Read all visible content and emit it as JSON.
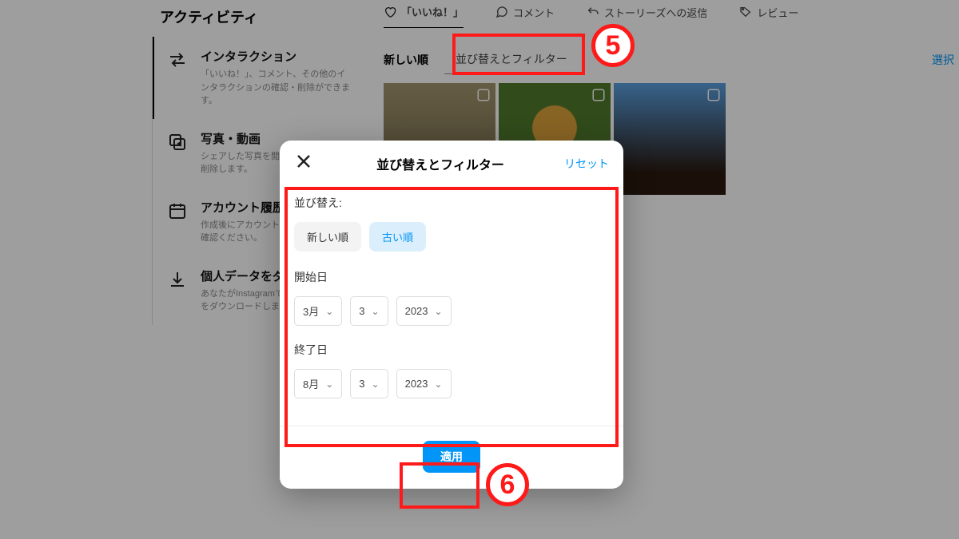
{
  "page_title": "アクティビティ",
  "tabs": [
    {
      "label": "「いいね！」"
    },
    {
      "label": "コメント"
    },
    {
      "label": "ストーリーズへの返信"
    },
    {
      "label": "レビュー"
    }
  ],
  "sidebar": {
    "items": [
      {
        "label": "インタラクション",
        "desc": "「いいね！」、コメント、その他のインタラクションの確認・削除ができます。"
      },
      {
        "label": "写真・動画",
        "desc": "シェアした写真を閲覧、アーカイブ、削除します。"
      },
      {
        "label": "アカウント履歴",
        "desc": "作成後にアカウントに加えた変更をご確認ください。"
      },
      {
        "label": "個人データをダウンロード",
        "desc": "あなたがInstagramでシェアした情報をダウンロードします。"
      }
    ]
  },
  "content_header": {
    "sort_label": "新しい順",
    "filter_label": "並び替えとフィルター",
    "select_label": "選択"
  },
  "modal": {
    "title": "並び替えとフィルター",
    "reset": "リセット",
    "sort_label": "並び替え:",
    "sort_options": {
      "newest": "新しい順",
      "oldest": "古い順"
    },
    "start_label": "開始日",
    "end_label": "終了日",
    "start_date": {
      "month": "3月",
      "day": "3",
      "year": "2023"
    },
    "end_date": {
      "month": "8月",
      "day": "3",
      "year": "2023"
    },
    "apply": "適用"
  },
  "annotations": {
    "step5": "5",
    "step6": "6"
  }
}
